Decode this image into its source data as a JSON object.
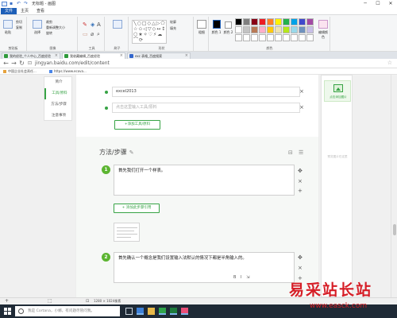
{
  "paint": {
    "title": "无标题 - 画图",
    "tabs": [
      "文件",
      "主页",
      "查看"
    ],
    "groups": {
      "clipboard": {
        "label": "剪贴板",
        "paste": "粘贴",
        "cut": "剪切",
        "copy": "复制"
      },
      "image": {
        "label": "图像",
        "select": "选择",
        "crop": "裁剪",
        "resize": "重新调整大小",
        "rotate": "旋转"
      },
      "tools": {
        "label": "工具"
      },
      "brushes": {
        "label": "刷子"
      },
      "shapes": {
        "label": "形状",
        "outline": "轮廓",
        "fill": "填充"
      },
      "size": {
        "label": "粗细"
      },
      "colors": {
        "label": "颜色",
        "color1": "颜色 1",
        "color2": "颜色 2",
        "edit": "编辑颜色"
      }
    },
    "shape_glyphs": "╲○□◇△▷⬠⬡ ☆✩◁▽◇↔↕⇨⇦ ⬡★✧♡⚡☁⌒⟳",
    "swatches": [
      "#000000",
      "#7f7f7f",
      "#880015",
      "#ed1c24",
      "#ff7f27",
      "#fff200",
      "#22b14c",
      "#00a2e8",
      "#3f48cc",
      "#a349a4",
      "#ffffff",
      "#c3c3c3",
      "#b97a57",
      "#ffaec9",
      "#ffc90e",
      "#efe4b0",
      "#b5e61d",
      "#99d9ea",
      "#7092be",
      "#c8bfe7",
      "#ffffff",
      "#ffffff",
      "#ffffff",
      "#ffffff",
      "#ffffff",
      "#ffffff",
      "#ffffff",
      "#ffffff",
      "#ffffff",
      "#ffffff"
    ]
  },
  "browser": {
    "tabs": [
      "我的经验_个人中心_百度经验",
      "我收藏编辑_百度经验",
      "exc 表格_百度搜索"
    ],
    "url": "jingyan.baidu.com/edit/content",
    "bookmarks": [
      "中国企业社会责任...",
      "https://www.ecova..."
    ]
  },
  "editor": {
    "side_menu": [
      "简介",
      "工具/原料",
      "方法/步骤",
      "注意事项"
    ],
    "tool_items": [
      "excel2013"
    ],
    "tool_placeholder": "点击这里输入工具/原料",
    "add_tool": "+添加工具/原料",
    "steps_title": "方法/步骤",
    "steps": [
      {
        "num": "1",
        "text": "首先我们打开一个样表。"
      },
      {
        "num": "2",
        "text": "首先确认一个概念是我们设置输入法默认的情况下都是半角输入的。"
      }
    ],
    "add_step_link": "+ 添加此步骤引用",
    "upload": "点击添加图片",
    "upload_hint": "预览图片在这里"
  },
  "status": {
    "dimensions": "1280 × 1024像素"
  },
  "taskbar": {
    "cortana": "我是 Cortana，小娜。有问题尽管问我。"
  },
  "watermark": {
    "main": "易采站长站",
    "sub": "www.easck.com"
  }
}
